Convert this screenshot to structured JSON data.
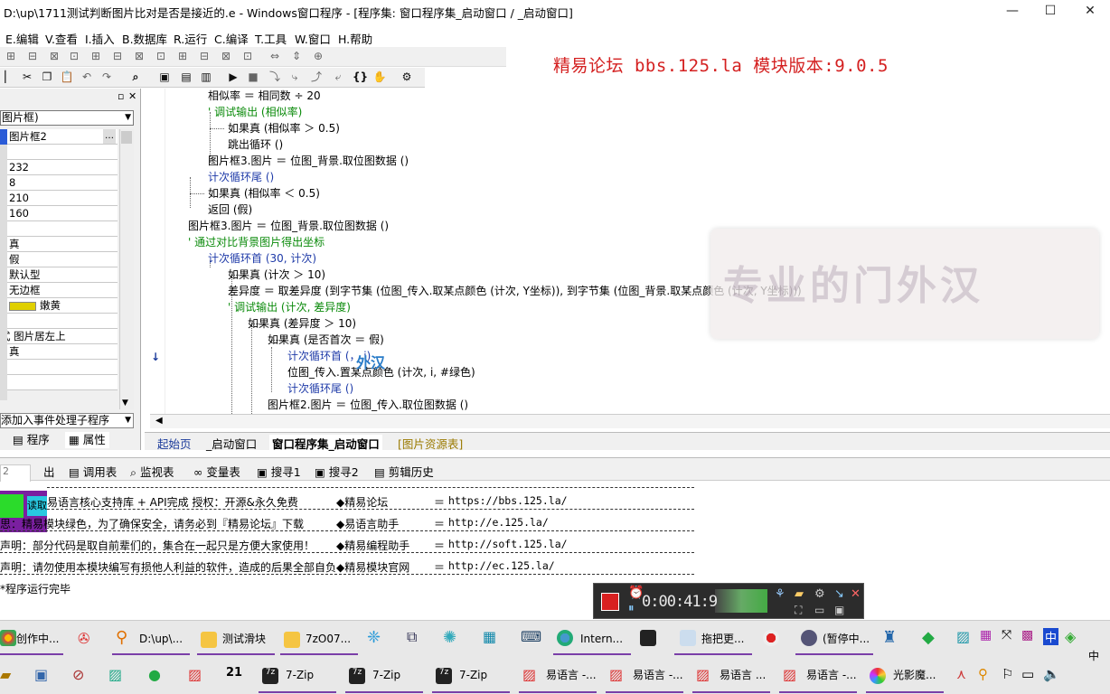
{
  "window": {
    "title": "D:\\up\\1711测试判断图片比对是否是接近的.e - Windows窗口程序 - [程序集: 窗口程序集_启动窗口 / _启动窗口]",
    "minimize": "—",
    "maximize": "☐",
    "close": "✕"
  },
  "menu": [
    "E.编辑",
    "V.查看",
    "I.插入",
    "B.数据库",
    "R.运行",
    "C.编译",
    "T.工具",
    "W.窗口",
    "H.帮助"
  ],
  "banner": "精易论坛 bbs.125.la 模块版本:9.0.5",
  "leftpanel": {
    "object_combo": "图片框)",
    "props": [
      "图片框2",
      "",
      "232",
      "8",
      "210",
      "160",
      "",
      "真",
      "假",
      "默认型",
      "无边框",
      "嫩黄",
      "",
      "图片居左上",
      "真",
      "",
      ""
    ],
    "prop_prefix": [
      "",
      "",
      "",
      "",
      "",
      "",
      "",
      "",
      "",
      "",
      "",
      "",
      "",
      "式",
      "",
      "",
      ""
    ],
    "color_swatch": "#e0d000",
    "event_combo": "添加入事件处理子程序",
    "tabs": [
      "程序",
      "属性"
    ]
  },
  "code": {
    "lines": [
      {
        "text": "相似率 ＝ 相同数 ÷ 20",
        "type": "code"
      },
      {
        "text": "' 调试输出 (相似率)",
        "type": "comment"
      },
      {
        "text": "如果真 (相似率 ＞ 0.5)",
        "type": "code"
      },
      {
        "text": "跳出循环 ()",
        "type": "code"
      },
      {
        "text": "图片框3.图片 ＝ 位图_背景.取位图数据 ()",
        "type": "code"
      },
      {
        "text": "计次循环尾 ()",
        "type": "code"
      },
      {
        "text": "如果真 (相似率 ＜ 0.5)",
        "type": "code"
      },
      {
        "text": "返回 (假)",
        "type": "code"
      },
      {
        "text": "图片框3.图片 ＝ 位图_背景.取位图数据 ()",
        "type": "code"
      },
      {
        "text": "' 通过对比背景图片得出坐标",
        "type": "comment"
      },
      {
        "text": "计次循环首 (30, 计次)",
        "type": "code"
      },
      {
        "text": "如果真 (计次 ＞ 10)",
        "type": "code"
      },
      {
        "text": "差异度 ＝ 取差异度 (到字节集 (位图_传入.取某点颜色 (计次, Y坐标)), 到字节集 (位图_背景.取某点颜色 (计次, Y坐标)))",
        "type": "code"
      },
      {
        "text": "' 调试输出 (计次, 差异度)",
        "type": "comment"
      },
      {
        "text": "如果真 (差异度 ＞ 10)",
        "type": "code"
      },
      {
        "text": "如果真 (是否首次 ＝ 假)",
        "type": "code"
      },
      {
        "text": "计次循环首 (， i)",
        "type": "code"
      },
      {
        "text": "位图_传入.置某点颜色 (计次, i, #绿色)",
        "type": "code"
      },
      {
        "text": "计次循环尾 ()",
        "type": "code"
      },
      {
        "text": "图片框2.图片 ＝ 位图_传入.取位图数据 ()",
        "type": "code"
      }
    ],
    "watermark": "专业的门外汉",
    "cursor_tag": "外汉"
  },
  "code_tabs": [
    "起始页",
    "_启动窗口",
    "窗口程序集_启动窗口",
    "[图片资源表]"
  ],
  "output_tabs": [
    "出",
    "调用表",
    "监视表",
    "变量表",
    "搜寻1",
    "搜寻2",
    "剪辑历史"
  ],
  "output": {
    "side_buttons": [
      "2",
      "",
      "读取"
    ],
    "rows": [
      {
        "left": "易语言核心支持库 + API完成        授权：开源&永久免费",
        "site": "◆精易论坛",
        "url": "https://bbs.125.la/"
      },
      {
        "left": "思：精易模块绿色，为了确保安全，请务必到『精易论坛』下载",
        "site": "◆易语言助手",
        "url": "http://e.125.la/"
      },
      {
        "left": "声明：部分代码是取自前辈们的，集合在一起只是方便大家使用！",
        "site": "◆精易编程助手",
        "url": "http://soft.125.la/"
      },
      {
        "left": "声明：请勿使用本模块编写有损他人利益的软件，造成的后果全部自负",
        "site": "◆精易模块官网",
        "url": "http://ec.125.la/"
      }
    ],
    "eq": "＝",
    "status": "*程序运行完毕"
  },
  "recorder": {
    "time": "0:00:41:9"
  },
  "taskbar": {
    "row1": [
      "创作中...",
      "D:\\up\\...",
      "测试滑块",
      "7zO07...",
      "Intern...",
      "拖把更...",
      "(暂停中..."
    ],
    "row2": [
      "7-Zip",
      "7-Zip",
      "7-Zip",
      "易语言 -...",
      "易语言 -...",
      "易语言 ...",
      "易语言 -...",
      "光影魔..."
    ],
    "ime": "中"
  },
  "colors": {
    "banner": "#d42020",
    "comment": "#0a8a0a",
    "taskbar_accent": "#7a3fa8"
  }
}
